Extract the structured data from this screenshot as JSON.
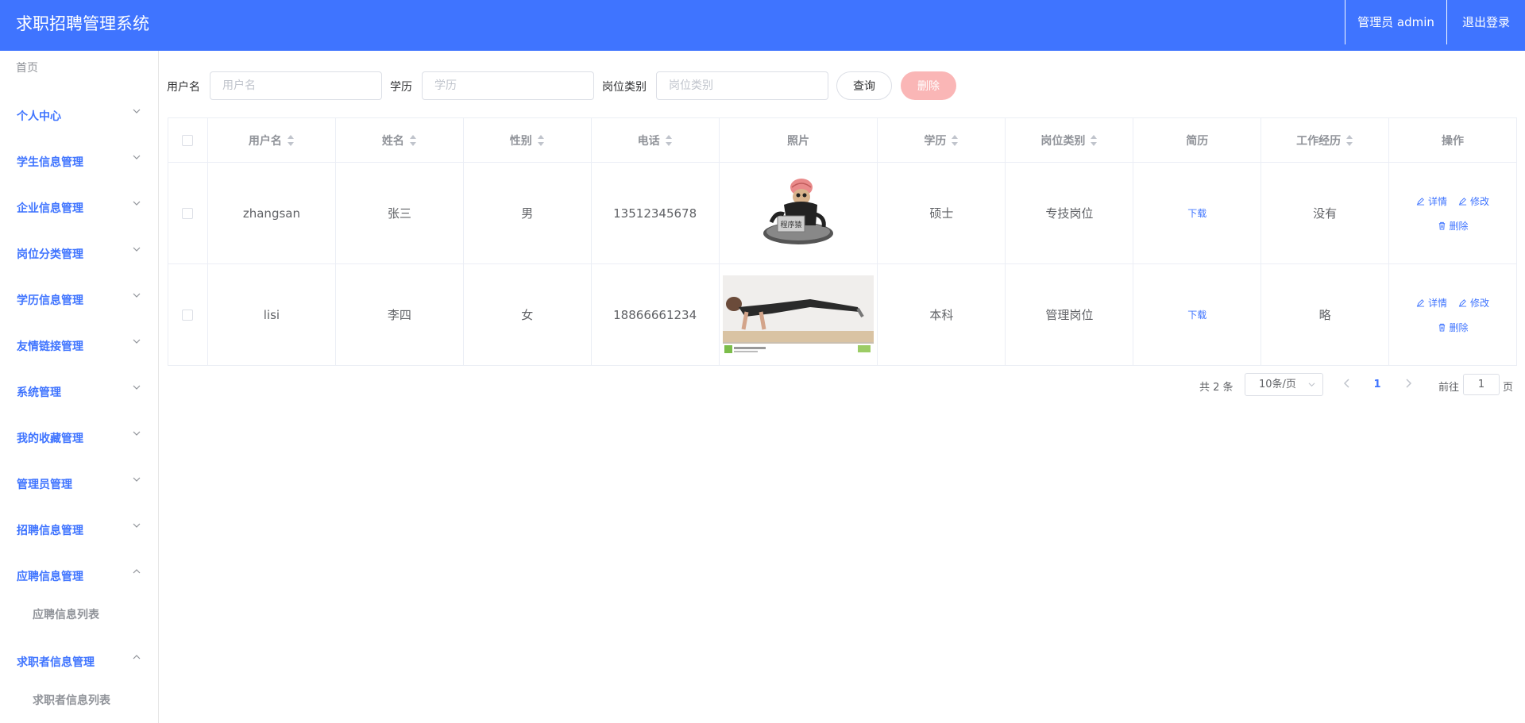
{
  "header": {
    "title": "求职招聘管理系统",
    "user_label": "管理员 admin",
    "logout_label": "退出登录",
    "bg_color": "#3f74ff"
  },
  "sidebar": {
    "home": "首页",
    "menus": [
      {
        "label": "个人中心",
        "expanded": false
      },
      {
        "label": "学生信息管理",
        "expanded": false
      },
      {
        "label": "企业信息管理",
        "expanded": false
      },
      {
        "label": "岗位分类管理",
        "expanded": false
      },
      {
        "label": "学历信息管理",
        "expanded": false
      },
      {
        "label": "友情链接管理",
        "expanded": false
      },
      {
        "label": "系统管理",
        "expanded": false
      },
      {
        "label": "我的收藏管理",
        "expanded": false
      },
      {
        "label": "管理员管理",
        "expanded": false
      },
      {
        "label": "招聘信息管理",
        "expanded": false
      },
      {
        "label": "应聘信息管理",
        "expanded": true,
        "sub": "应聘信息列表"
      },
      {
        "label": "求职者信息管理",
        "expanded": true,
        "sub": "求职者信息列表"
      }
    ]
  },
  "search": {
    "username_label": "用户名",
    "username_placeholder": "用户名",
    "education_label": "学历",
    "education_placeholder": "学历",
    "job_type_label": "岗位类别",
    "job_type_placeholder": "岗位类别",
    "query_label": "查询",
    "delete_label": "删除"
  },
  "table": {
    "columns": [
      "用户名",
      "姓名",
      "性别",
      "电话",
      "照片",
      "学历",
      "岗位类别",
      "简历",
      "工作经历",
      "操作"
    ],
    "rows": [
      {
        "username": "zhangsan",
        "name": "张三",
        "gender": "男",
        "phone": "13512345678",
        "photo": "程序猿",
        "education": "硕士",
        "job_type": "专技岗位",
        "resume": "下载",
        "experience": "没有"
      },
      {
        "username": "lisi",
        "name": "李四",
        "gender": "女",
        "phone": "18866661234",
        "photo": "",
        "education": "本科",
        "job_type": "管理岗位",
        "resume": "下载",
        "experience": "略"
      }
    ],
    "op_detail": "详情",
    "op_edit": "修改",
    "op_delete": "删除"
  },
  "pagination": {
    "total": "共 2 条",
    "page_size": "10条/页",
    "current": "1",
    "goto_label": "前往",
    "goto_value": "1",
    "page_unit": "页"
  },
  "icons": {
    "chevron": "chevron-icon",
    "edit": "edit-icon",
    "delete": "trash-icon"
  }
}
